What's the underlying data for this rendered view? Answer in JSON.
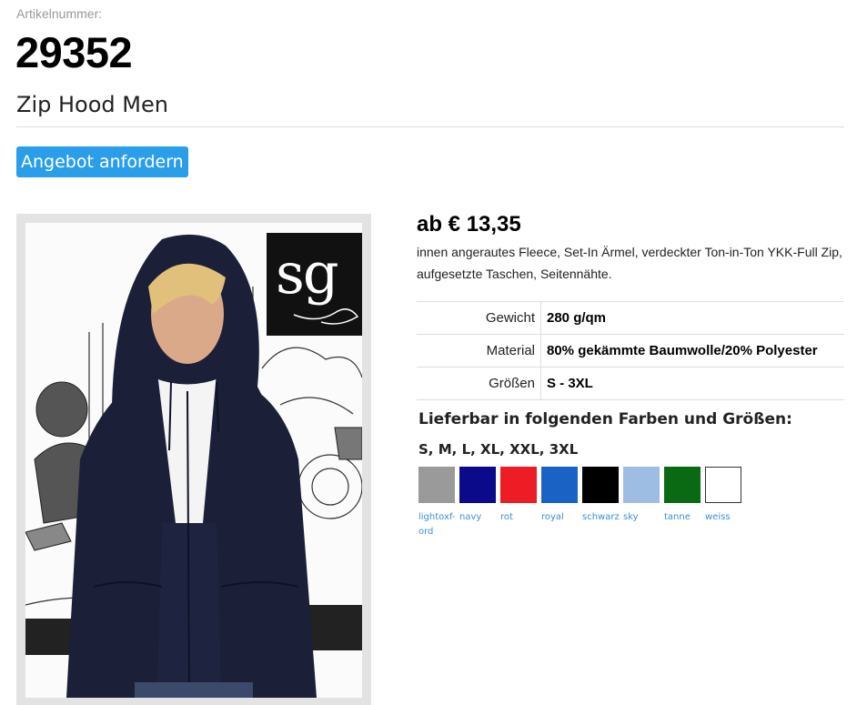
{
  "article": {
    "label": "Artikelnummer:",
    "number": "29352"
  },
  "product": {
    "name": "Zip Hood Men"
  },
  "actions": {
    "offer_label": "Angebot anfordern"
  },
  "image": {
    "logo_text": "sg"
  },
  "price": "ab € 13,35",
  "description": "innen angerautes Fleece, Set-In Ärmel, verdeckter Ton-in-Ton YKK-Full Zip, aufgesetzte Taschen, Seitennähte.",
  "specs": [
    {
      "label": "Gewicht",
      "value": "280 g/qm"
    },
    {
      "label": "Material",
      "value": "80% gekämmte Baumwolle/20% Polyester"
    },
    {
      "label": "Größen",
      "value": "S - 3XL"
    }
  ],
  "availability": {
    "heading": "Lieferbar in folgenden Farben und Größen:",
    "sizes": "S, M, L, XL, XXL, 3XL"
  },
  "colors": [
    {
      "name": "lightoxf-ord",
      "hex": "#9a9a9a"
    },
    {
      "name": "navy",
      "hex": "#0a0a8a"
    },
    {
      "name": "rot",
      "hex": "#ee1c25"
    },
    {
      "name": "royal",
      "hex": "#1a63c4"
    },
    {
      "name": "schwarz",
      "hex": "#000000"
    },
    {
      "name": "sky",
      "hex": "#9dbde3"
    },
    {
      "name": "tanne",
      "hex": "#0a6a14"
    },
    {
      "name": "weiss",
      "hex": "#ffffff"
    }
  ]
}
